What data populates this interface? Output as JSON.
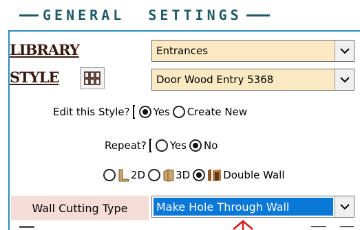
{
  "header": {
    "title": "GENERAL  SETTINGS"
  },
  "library": {
    "label": "LIBRARY",
    "value": "Entrances"
  },
  "style": {
    "label": "STYLE",
    "value": "Door Wood Entry 5368"
  },
  "edit_style": {
    "question": "Edit this Style?",
    "options": [
      "Yes",
      "Create New"
    ],
    "selected": "Yes"
  },
  "repeat": {
    "question": "Repeat?",
    "options": [
      "Yes",
      "No"
    ],
    "selected": "No"
  },
  "view_mode": {
    "options": [
      "2D",
      "3D",
      "Double Wall"
    ],
    "selected": "Double Wall"
  },
  "wall_cutting": {
    "label": "Wall Cutting Type",
    "value": "Make Hole Through Wall"
  },
  "colors": {
    "accent": "#2b8bbf",
    "header": "#1f5a66",
    "combo_bg": "#fbe9c4",
    "selection": "#0a78d7"
  }
}
